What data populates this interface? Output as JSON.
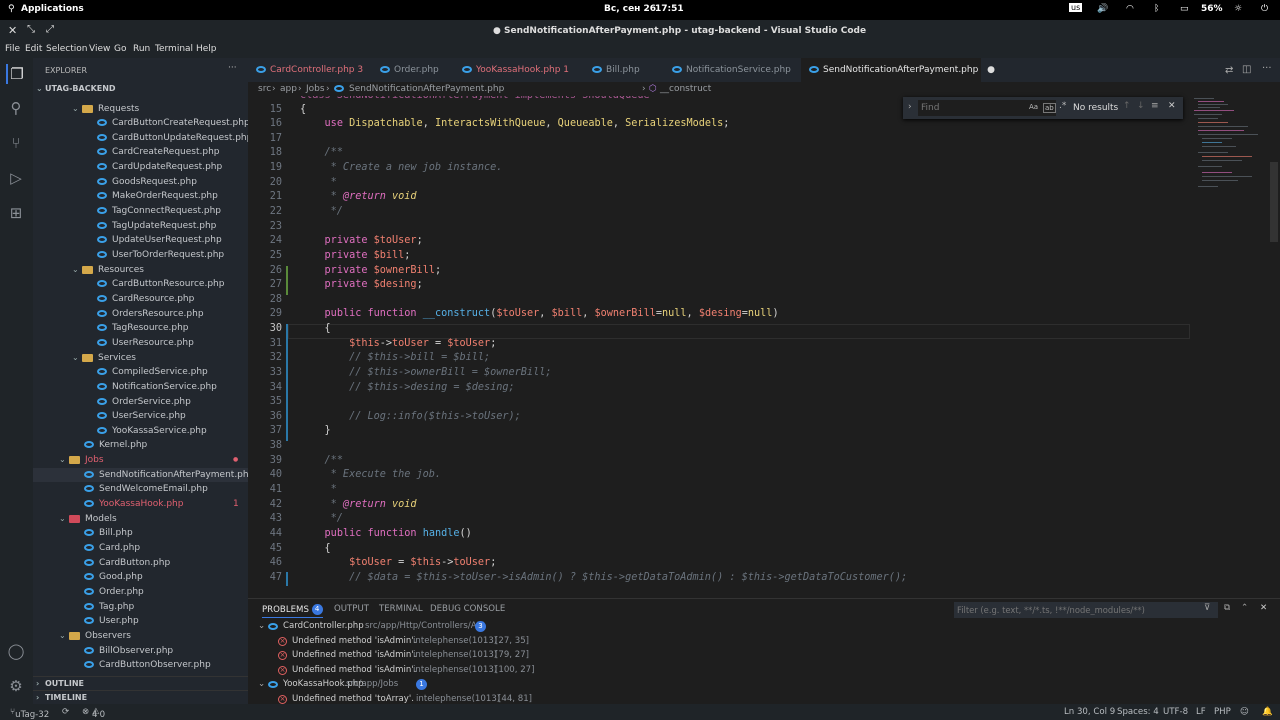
{
  "system": {
    "apps": "Applications",
    "date": "Вс, сен 26",
    "time": "17:51",
    "keyboard": "us",
    "battery": "56%"
  },
  "window": {
    "title": "● SendNotificationAfterPayment.php - utag-backend - Visual Studio Code"
  },
  "menu": [
    "File",
    "Edit",
    "Selection",
    "View",
    "Go",
    "Run",
    "Terminal",
    "Help"
  ],
  "sidebar": {
    "header": "EXPLORER",
    "project": "UTAG-BACKEND",
    "tree": [
      {
        "label": "Requests",
        "type": "folder",
        "indent": 1,
        "open": true,
        "color": "folder"
      },
      {
        "label": "CardButtonCreateRequest.php",
        "type": "file",
        "indent": 2
      },
      {
        "label": "CardButtonUpdateRequest.php",
        "type": "file",
        "indent": 2
      },
      {
        "label": "CardCreateRequest.php",
        "type": "file",
        "indent": 2
      },
      {
        "label": "CardUpdateRequest.php",
        "type": "file",
        "indent": 2
      },
      {
        "label": "GoodsRequest.php",
        "type": "file",
        "indent": 2
      },
      {
        "label": "MakeOrderRequest.php",
        "type": "file",
        "indent": 2
      },
      {
        "label": "TagConnectRequest.php",
        "type": "file",
        "indent": 2
      },
      {
        "label": "TagUpdateRequest.php",
        "type": "file",
        "indent": 2
      },
      {
        "label": "UpdateUserRequest.php",
        "type": "file",
        "indent": 2
      },
      {
        "label": "UserToOrderRequest.php",
        "type": "file",
        "indent": 2
      },
      {
        "label": "Resources",
        "type": "folder",
        "indent": 1,
        "open": true,
        "color": "folder"
      },
      {
        "label": "CardButtonResource.php",
        "type": "file",
        "indent": 2
      },
      {
        "label": "CardResource.php",
        "type": "file",
        "indent": 2
      },
      {
        "label": "OrdersResource.php",
        "type": "file",
        "indent": 2
      },
      {
        "label": "TagResource.php",
        "type": "file",
        "indent": 2
      },
      {
        "label": "UserResource.php",
        "type": "file",
        "indent": 2
      },
      {
        "label": "Services",
        "type": "folder",
        "indent": 1,
        "open": true,
        "color": "folder"
      },
      {
        "label": "CompiledService.php",
        "type": "file",
        "indent": 2
      },
      {
        "label": "NotificationService.php",
        "type": "file",
        "indent": 2
      },
      {
        "label": "OrderService.php",
        "type": "file",
        "indent": 2
      },
      {
        "label": "UserService.php",
        "type": "file",
        "indent": 2
      },
      {
        "label": "YooKassaService.php",
        "type": "file",
        "indent": 2
      },
      {
        "label": "Kernel.php",
        "type": "file",
        "indent": 1
      },
      {
        "label": "Jobs",
        "type": "folder",
        "indent": 0,
        "open": true,
        "color": "folder",
        "error": true
      },
      {
        "label": "SendNotificationAfterPayment.php",
        "type": "file",
        "indent": 1,
        "selected": true
      },
      {
        "label": "SendWelcomeEmail.php",
        "type": "file",
        "indent": 1
      },
      {
        "label": "YooKassaHook.php",
        "type": "file",
        "indent": 1,
        "error": true,
        "badge": "1"
      },
      {
        "label": "Models",
        "type": "folder",
        "indent": 0,
        "open": true,
        "color": "red"
      },
      {
        "label": "Bill.php",
        "type": "file",
        "indent": 1
      },
      {
        "label": "Card.php",
        "type": "file",
        "indent": 1
      },
      {
        "label": "CardButton.php",
        "type": "file",
        "indent": 1
      },
      {
        "label": "Good.php",
        "type": "file",
        "indent": 1
      },
      {
        "label": "Order.php",
        "type": "file",
        "indent": 1
      },
      {
        "label": "Tag.php",
        "type": "file",
        "indent": 1
      },
      {
        "label": "User.php",
        "type": "file",
        "indent": 1
      },
      {
        "label": "Observers",
        "type": "folder",
        "indent": 0,
        "open": true,
        "color": "folder"
      },
      {
        "label": "BillObserver.php",
        "type": "file",
        "indent": 1
      },
      {
        "label": "CardButtonObserver.php",
        "type": "file",
        "indent": 1
      }
    ],
    "outline": "OUTLINE",
    "timeline": "TIMELINE"
  },
  "tabs": [
    {
      "label": "CardController.php 3",
      "color": "#e0707a"
    },
    {
      "label": "Order.php",
      "color": "#8c949c"
    },
    {
      "label": "YooKassaHook.php 1",
      "color": "#e0707a"
    },
    {
      "label": "Bill.php",
      "color": "#8c949c"
    },
    {
      "label": "NotificationService.php",
      "color": "#8c949c"
    },
    {
      "label": "SendNotificationAfterPayment.php",
      "color": "#e6e6e6",
      "active": true
    }
  ],
  "breadcrumb": [
    "src",
    "app",
    "Jobs",
    "SendNotificationAfterPayment.php",
    "__construct"
  ],
  "find": {
    "placeholder": "Find",
    "result": "No results",
    "aa": "Aa",
    "word": "ab"
  },
  "code": [
    {
      "n": "15",
      "html": "<span class=\"cl2\">{</span>"
    },
    {
      "n": "16",
      "html": "    <span class=\"kw\">use</span> <span class=\"cls\">Dispatchable</span>, <span class=\"cls\">InteractsWithQueue</span>, <span class=\"cls\">Queueable</span>, <span class=\"cls\">SerializesModels</span>;"
    },
    {
      "n": "17",
      "html": ""
    },
    {
      "n": "18",
      "html": "    <span class=\"cm\">/**</span>"
    },
    {
      "n": "19",
      "html": "<span class=\"cm\">     * Create a new job instance.</span>"
    },
    {
      "n": "20",
      "html": "<span class=\"cm\">     *</span>"
    },
    {
      "n": "21",
      "html": "<span class=\"cm\">     * </span><span class=\"tag\">@return</span> <span class=\"cls\" style=\"font-style:italic\">void</span>"
    },
    {
      "n": "22",
      "html": "<span class=\"cm\">     */</span>"
    },
    {
      "n": "23",
      "html": ""
    },
    {
      "n": "24",
      "html": "    <span class=\"kw\">private</span> <span class=\"var\">$toUser</span>;"
    },
    {
      "n": "25",
      "html": "    <span class=\"kw\">private</span> <span class=\"var\">$bill</span>;"
    },
    {
      "n": "26",
      "html": "    <span class=\"kw\">private</span> <span class=\"var\">$ownerBill</span>;"
    },
    {
      "n": "27",
      "html": "    <span class=\"kw\">private</span> <span class=\"var\">$desing</span>;"
    },
    {
      "n": "28",
      "html": ""
    },
    {
      "n": "29",
      "html": "    <span class=\"kw\">public</span> <span class=\"kw\">function</span> <span class=\"fn\">__construct</span>(<span class=\"var\">$toUser</span>, <span class=\"var\">$bill</span>, <span class=\"var\">$ownerBill</span>=<span class=\"cls\">null</span>, <span class=\"var\">$desing</span>=<span class=\"cls\">null</span>)"
    },
    {
      "n": "30",
      "html": "    {"
    },
    {
      "n": "31",
      "html": "        <span class=\"var\">$this</span>-&gt;<span class=\"var\">toUser</span> = <span class=\"var\">$toUser</span>;"
    },
    {
      "n": "32",
      "html": "<span class=\"cm\">        // $this->bill = $bill;</span>"
    },
    {
      "n": "33",
      "html": "<span class=\"cm\">        // $this->ownerBill = $ownerBill;</span>"
    },
    {
      "n": "34",
      "html": "<span class=\"cm\">        // $this->desing = $desing;</span>"
    },
    {
      "n": "35",
      "html": ""
    },
    {
      "n": "36",
      "html": "<span class=\"cm\">        // Log::info($this->toUser);</span>"
    },
    {
      "n": "37",
      "html": "    }"
    },
    {
      "n": "38",
      "html": ""
    },
    {
      "n": "39",
      "html": "    <span class=\"cm\">/**</span>"
    },
    {
      "n": "40",
      "html": "<span class=\"cm\">     * Execute the job.</span>"
    },
    {
      "n": "41",
      "html": "<span class=\"cm\">     *</span>"
    },
    {
      "n": "42",
      "html": "<span class=\"cm\">     * </span><span class=\"tag\">@return</span> <span class=\"cls\" style=\"font-style:italic\">void</span>"
    },
    {
      "n": "43",
      "html": "<span class=\"cm\">     */</span>"
    },
    {
      "n": "44",
      "html": "    <span class=\"kw\">public</span> <span class=\"kw\">function</span> <span class=\"fn\">handle</span>()"
    },
    {
      "n": "45",
      "html": "    {"
    },
    {
      "n": "46",
      "html": "        <span class=\"var\">$toUser</span> = <span class=\"var\">$this</span>-&gt;<span class=\"var\">toUser</span>;"
    },
    {
      "n": "47",
      "html": "<span class=\"cm\">        // $data = $this->toUser->isAdmin() ? $this->getDataToAdmin() : $this->getDataToCustomer();</span>"
    }
  ],
  "panel": {
    "tabs": [
      "PROBLEMS",
      "OUTPUT",
      "TERMINAL",
      "DEBUG CONSOLE"
    ],
    "problems_count": "4",
    "filter_placeholder": "Filter (e.g. text, **/*.ts, !**/node_modules/**)",
    "groups": [
      {
        "file": "CardController.php",
        "path": "src/app/Http/Controllers/API",
        "count": "3",
        "items": [
          {
            "msg": "Undefined method 'isAdmin'.",
            "src": "intelephense(1013)",
            "loc": "[27, 35]"
          },
          {
            "msg": "Undefined method 'isAdmin'.",
            "src": "intelephense(1013)",
            "loc": "[79, 27]"
          },
          {
            "msg": "Undefined method 'isAdmin'.",
            "src": "intelephense(1013)",
            "loc": "[100, 27]"
          }
        ]
      },
      {
        "file": "YooKassaHook.php",
        "path": "src/app/Jobs",
        "count": "1",
        "items": [
          {
            "msg": "Undefined method 'toArray'.",
            "src": "intelephense(1013)",
            "loc": "[44, 81]"
          }
        ]
      }
    ]
  },
  "status": {
    "branch": "uTag-32",
    "problems": "4",
    "warnings": "0",
    "position": "Ln 30, Col 9",
    "spaces": "Spaces: 4",
    "encoding": "UTF-8",
    "eol": "LF",
    "lang": "PHP"
  },
  "colors": {
    "accent": "#3a78e0",
    "error": "#e06060",
    "keyword": "#e06fc0",
    "variable": "#f08070"
  }
}
